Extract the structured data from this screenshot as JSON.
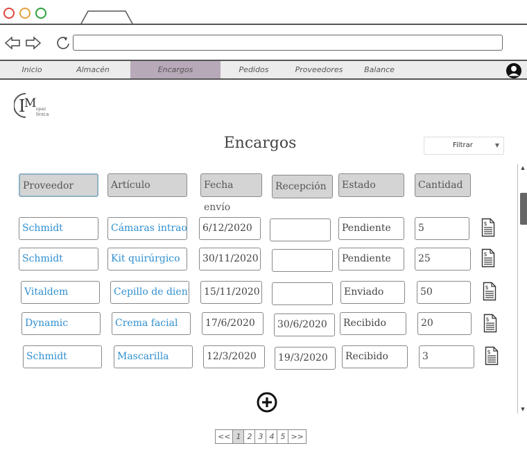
{
  "browser": {
    "url": ""
  },
  "menu": {
    "items": [
      {
        "label": "Inicio"
      },
      {
        "label": "Almacén"
      },
      {
        "label": "Encargos",
        "active": true
      },
      {
        "label": "Pedidos"
      },
      {
        "label": "Proveedores"
      },
      {
        "label": "Balance"
      }
    ]
  },
  "logo": {
    "text": "MC López Clínica"
  },
  "page": {
    "title": "Encargos"
  },
  "filter": {
    "label": "Filtrar"
  },
  "table": {
    "columns": [
      "Proveedor",
      "Artículo",
      "Fecha envío",
      "Recepción",
      "Estado",
      "Cantidad"
    ],
    "rows": [
      {
        "proveedor": "Schmidt",
        "articulo": "Cámaras intraoral",
        "fecha_envio": "6/12/2020",
        "recepcion": "",
        "estado": "Pendiente",
        "cantidad": "5"
      },
      {
        "proveedor": "Schmidt",
        "articulo": "Kit quirúrgico",
        "fecha_envio": "30/11/2020",
        "recepcion": "",
        "estado": "Pendiente",
        "cantidad": "25"
      },
      {
        "proveedor": "Vitaldem",
        "articulo": "Cepillo de diente",
        "fecha_envio": "15/11/2020",
        "recepcion": "",
        "estado": "Enviado",
        "cantidad": "50"
      },
      {
        "proveedor": "Dynamic",
        "articulo": "Crema facial",
        "fecha_envio": "17/6/2020",
        "recepcion": "30/6/2020",
        "estado": "Recibido",
        "cantidad": "20"
      },
      {
        "proveedor": "Schmidt",
        "articulo": "Mascarilla",
        "fecha_envio": "12/3/2020",
        "recepcion": "19/3/2020",
        "estado": "Recibido",
        "cantidad": "3"
      }
    ]
  },
  "pagination": {
    "items": [
      "<<",
      "1",
      "2",
      "3",
      "4",
      "5",
      ">>"
    ],
    "current": "1"
  },
  "colors": {
    "link": "#2f8fd0",
    "active_tab": "#b8a9b8",
    "header_bg": "#d4d4d4"
  }
}
